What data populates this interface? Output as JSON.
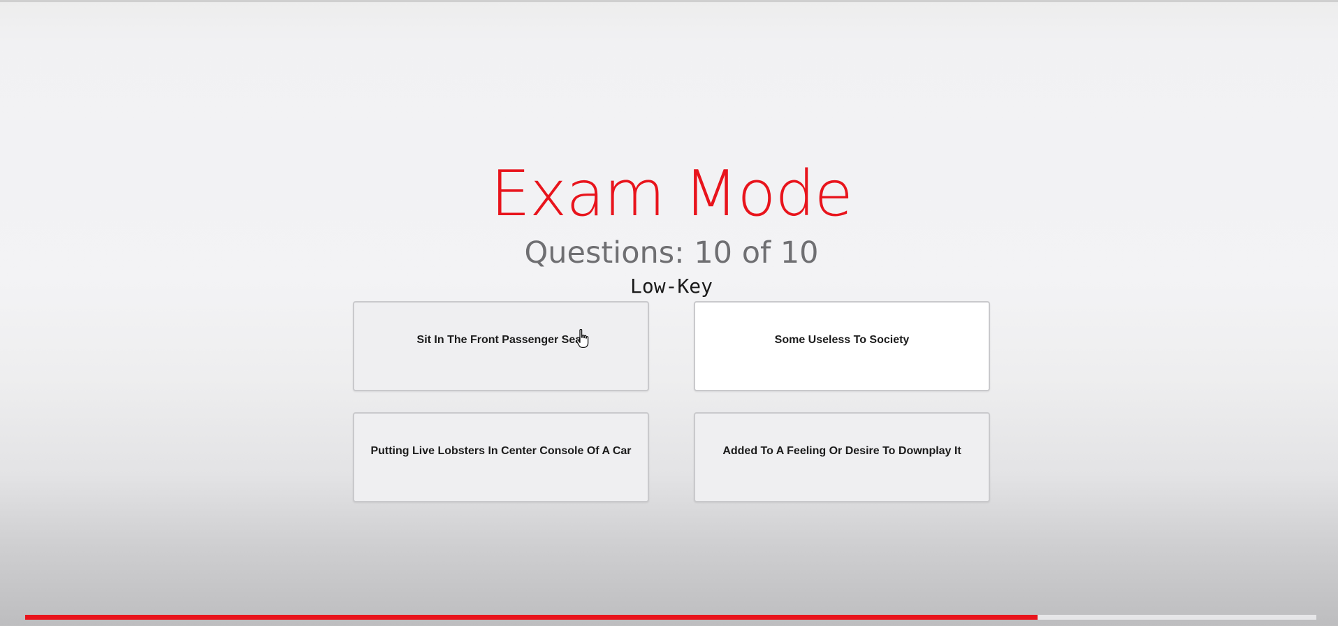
{
  "quiz": {
    "title": "Exam Mode",
    "counter": "Questions: 10 of 10",
    "term": "Low-Key",
    "answers": [
      "Sit In The Front Passenger Seat",
      "Some Useless To Society",
      "Putting Live Lobsters In Center Console Of A Car",
      "Added To A Feeling Or Desire To Downplay It"
    ]
  },
  "progress": {
    "fraction": 0.784
  },
  "colors": {
    "accent": "#e8141c",
    "counter_text": "#6f6f72",
    "answer_border": "#c9c9cc",
    "answer_background": "#efeff1",
    "answer_hover_background": "#ffffff"
  },
  "icons": {
    "cursor": "hand-pointer-icon"
  }
}
